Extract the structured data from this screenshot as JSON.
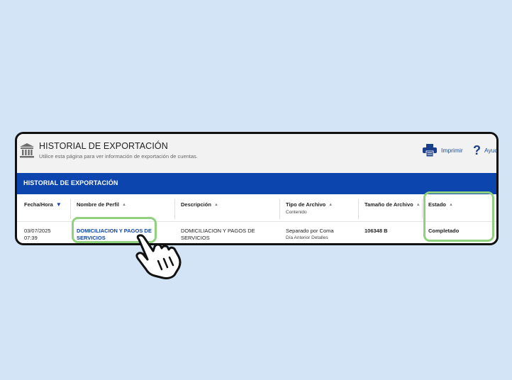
{
  "header": {
    "title": "HISTORIAL DE EXPORTACIÓN",
    "subtitle": "Utilice esta página para ver información de exportación de cuentas.",
    "print_label": "Imprimir",
    "help_label": "Ayuda"
  },
  "banner": {
    "title": "HISTORIAL DE EXPORTACIÓN"
  },
  "table": {
    "columns": [
      {
        "label": "Fecha/Hora",
        "sub": ""
      },
      {
        "label": "Nombre de Perfil",
        "sub": ""
      },
      {
        "label": "Descripción",
        "sub": ""
      },
      {
        "label": "Tipo de Archivo",
        "sub": "Contenido"
      },
      {
        "label": "Tamaño de Archivo",
        "sub": ""
      },
      {
        "label": "Estado",
        "sub": ""
      }
    ],
    "rows": [
      {
        "date": "03/07/2025",
        "time": "07:39",
        "profile_line1": "DOMICILIACION Y PAGOS DE",
        "profile_line2": "SERVICIOS",
        "desc_line1": "DOMICILIACION Y PAGOS DE",
        "desc_line2": "SERVICIOS",
        "file_type": "Separado por Coma",
        "content": "Día Anterior Detalles",
        "size": "106348 B",
        "status": "Completado"
      }
    ]
  },
  "icons": {
    "bank": "bank-icon",
    "print": "printer-icon",
    "help": "question-icon",
    "sort_active": "sort-desc-icon",
    "sort": "sort-asc-icon",
    "pointer": "hand-pointer-icon"
  },
  "colors": {
    "page_bg": "#d3e4f6",
    "banner": "#0b45ad",
    "link": "#0b45ad",
    "highlight": "#8fd17e"
  }
}
